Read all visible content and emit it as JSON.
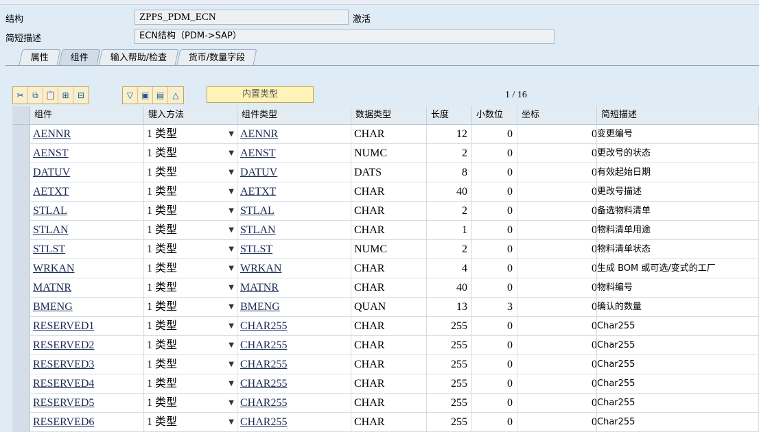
{
  "header": {
    "struct_label": "结构",
    "struct_value": "ZPPS_PDM_ECN",
    "status": "激活",
    "desc_label": "简短描述",
    "desc_value": "ECN结构（PDM->SAP）"
  },
  "tabs": [
    {
      "label": "属性"
    },
    {
      "label": "组件"
    },
    {
      "label": "输入帮助/检查"
    },
    {
      "label": "货币/数量字段"
    }
  ],
  "toolbar": {
    "builtin_type_label": "内置类型",
    "pager": "1 / 16",
    "icons": [
      "cut-icon",
      "copy-icon",
      "paste-icon",
      "insert-row-icon",
      "delete-row-icon",
      "filter-icon",
      "details-icon",
      "table-icon",
      "collapse-icon"
    ]
  },
  "columns": [
    "组件",
    "键入方法",
    "组件类型",
    "数据类型",
    "长度",
    "小数位",
    "坐标",
    "简短描述"
  ],
  "rows": [
    {
      "comp": "AENNR",
      "entry": "1 类型",
      "ctype": "AENNR",
      "dtype": "CHAR",
      "len": "12",
      "dec": "0",
      "coord": "0",
      "desc": "变更编号"
    },
    {
      "comp": "AENST",
      "entry": "1 类型",
      "ctype": "AENST",
      "dtype": "NUMC",
      "len": "2",
      "dec": "0",
      "coord": "0",
      "desc": "更改号的状态"
    },
    {
      "comp": "DATUV",
      "entry": "1 类型",
      "ctype": "DATUV",
      "dtype": "DATS",
      "len": "8",
      "dec": "0",
      "coord": "0",
      "desc": "有效起始日期"
    },
    {
      "comp": "AETXT",
      "entry": "1 类型",
      "ctype": "AETXT",
      "dtype": "CHAR",
      "len": "40",
      "dec": "0",
      "coord": "0",
      "desc": "更改号描述"
    },
    {
      "comp": "STLAL",
      "entry": "1 类型",
      "ctype": "STLAL",
      "dtype": "CHAR",
      "len": "2",
      "dec": "0",
      "coord": "0",
      "desc": "备选物料清单"
    },
    {
      "comp": "STLAN",
      "entry": "1 类型",
      "ctype": "STLAN",
      "dtype": "CHAR",
      "len": "1",
      "dec": "0",
      "coord": "0",
      "desc": "物料清单用途"
    },
    {
      "comp": "STLST",
      "entry": "1 类型",
      "ctype": "STLST",
      "dtype": "NUMC",
      "len": "2",
      "dec": "0",
      "coord": "0",
      "desc": "物料清单状态"
    },
    {
      "comp": "WRKAN",
      "entry": "1 类型",
      "ctype": "WRKAN",
      "dtype": "CHAR",
      "len": "4",
      "dec": "0",
      "coord": "0",
      "desc": "生成 BOM 或可选/变式的工厂"
    },
    {
      "comp": "MATNR",
      "entry": "1 类型",
      "ctype": "MATNR",
      "dtype": "CHAR",
      "len": "40",
      "dec": "0",
      "coord": "0",
      "desc": "物料编号"
    },
    {
      "comp": "BMENG",
      "entry": "1 类型",
      "ctype": "BMENG",
      "dtype": "QUAN",
      "len": "13",
      "dec": "3",
      "coord": "0",
      "desc": "确认的数量"
    },
    {
      "comp": "RESERVED1",
      "entry": "1 类型",
      "ctype": "CHAR255",
      "dtype": "CHAR",
      "len": "255",
      "dec": "0",
      "coord": "0",
      "desc": "Char255"
    },
    {
      "comp": "RESERVED2",
      "entry": "1 类型",
      "ctype": "CHAR255",
      "dtype": "CHAR",
      "len": "255",
      "dec": "0",
      "coord": "0",
      "desc": "Char255"
    },
    {
      "comp": "RESERVED3",
      "entry": "1 类型",
      "ctype": "CHAR255",
      "dtype": "CHAR",
      "len": "255",
      "dec": "0",
      "coord": "0",
      "desc": "Char255"
    },
    {
      "comp": "RESERVED4",
      "entry": "1 类型",
      "ctype": "CHAR255",
      "dtype": "CHAR",
      "len": "255",
      "dec": "0",
      "coord": "0",
      "desc": "Char255"
    },
    {
      "comp": "RESERVED5",
      "entry": "1 类型",
      "ctype": "CHAR255",
      "dtype": "CHAR",
      "len": "255",
      "dec": "0",
      "coord": "0",
      "desc": "Char255"
    },
    {
      "comp": "RESERVED6",
      "entry": "1 类型",
      "ctype": "CHAR255",
      "dtype": "CHAR",
      "len": "255",
      "dec": "0",
      "coord": "0",
      "desc": "Char255"
    }
  ]
}
